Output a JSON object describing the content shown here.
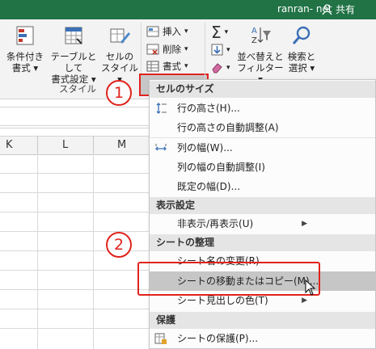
{
  "titlebar": {
    "user_name": "ranran- net",
    "share_label": "共有"
  },
  "ribbon": {
    "conditional_format": [
      "条件付き",
      "書式"
    ],
    "format_as_table": [
      "テーブルとして",
      "書式設定"
    ],
    "cell_styles": [
      "セルの",
      "スタイル"
    ],
    "group_style": "スタイル",
    "insert_label": "挿入",
    "delete_label": "削除",
    "format_label": "書式",
    "sort_filter": [
      "並べ替えと",
      "フィルター"
    ],
    "find_select": [
      "検索と",
      "選択"
    ]
  },
  "columns": [
    "K",
    "L",
    "M"
  ],
  "partial_column": "(",
  "menu": {
    "sections": {
      "cell_size": "セルのサイズ",
      "visibility": "表示設定",
      "organize": "シートの整理",
      "protect": "保護"
    },
    "items": {
      "row_height": "行の高さ(H)...",
      "autofit_row": "行の高さの自動調整(A)",
      "col_width": "列の幅(W)...",
      "autofit_col": "列の幅の自動調整(I)",
      "default_width": "既定の幅(D)...",
      "hide_unhide": "非表示/再表示(U)",
      "rename_sheet": "シート名の変更(R)",
      "move_copy": "シートの移動またはコピー(M)...",
      "tab_color": "シート見出しの色(T)",
      "protect_sheet": "シートの保護(P)..."
    }
  },
  "annotations": {
    "step1": "1",
    "step2": "2"
  },
  "colors": {
    "title_bar": "#217346",
    "annotation_red": "#e0231c",
    "highlight": "#c6c6c6"
  }
}
